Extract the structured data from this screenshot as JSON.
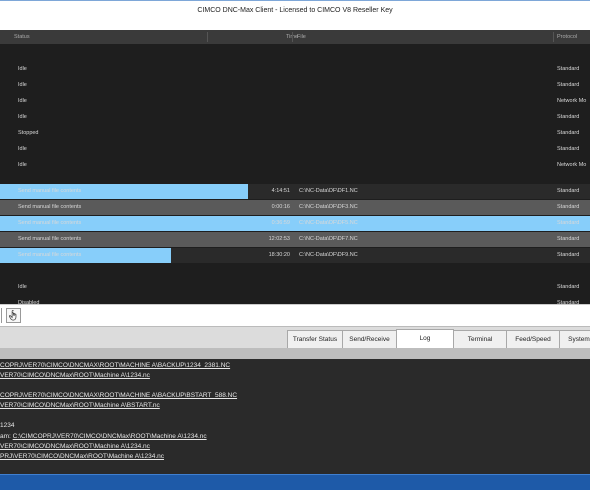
{
  "window": {
    "title": "CIMCO DNC-Max Client - Licensed to CIMCO V8 Reseller Key"
  },
  "grid": {
    "columns": {
      "status": "Status",
      "time": "Time",
      "file": "File",
      "protocol": "Protocol"
    },
    "rows": [
      {
        "status": "Idle",
        "time": "",
        "file": "",
        "protocol": "Standard"
      },
      {
        "status": "Idle",
        "time": "",
        "file": "",
        "protocol": "Standard"
      },
      {
        "status": "Idle",
        "time": "",
        "file": "",
        "protocol": "Network Mo"
      },
      {
        "status": "Idle",
        "time": "",
        "file": "",
        "protocol": "Standard"
      },
      {
        "status": "Stopped",
        "time": "",
        "file": "",
        "protocol": "Standard"
      },
      {
        "status": "Idle",
        "time": "",
        "file": "",
        "protocol": "Standard"
      },
      {
        "status": "Idle",
        "time": "",
        "file": "",
        "protocol": "Network Mo"
      },
      {
        "status": "Send manual file contents",
        "time": "4:14:51",
        "file": "C:\\NC-Data\\DF\\DF1.NC",
        "protocol": "Standard",
        "progress": 0.42
      },
      {
        "status": "Send manual file contents",
        "time": "0:00:16",
        "file": "C:\\NC-Data\\DF\\DF3.NC",
        "protocol": "Standard",
        "progress": 0
      },
      {
        "status": "Send manual file contents",
        "time": "0:36:59",
        "file": "C:\\NC-Data\\DF\\DF5.NC",
        "protocol": "Standard",
        "progress": 1
      },
      {
        "status": "Send manual file contents",
        "time": "12:02:53",
        "file": "C:\\NC-Data\\DF\\DF7.NC",
        "protocol": "Standard",
        "progress": 0
      },
      {
        "status": "Send manual file contents",
        "time": "18:30:20",
        "file": "C:\\NC-Data\\DF\\DF9.NC",
        "protocol": "Standard",
        "progress": 0.29
      },
      {
        "status": "Idle",
        "time": "",
        "file": "",
        "protocol": "Standard"
      },
      {
        "status": "Disabled",
        "time": "",
        "file": "",
        "protocol": "Standard"
      }
    ]
  },
  "tabs": [
    {
      "label": "Transfer Status"
    },
    {
      "label": "Send/Receive"
    },
    {
      "label": "Log",
      "active": true
    },
    {
      "label": "Terminal"
    },
    {
      "label": "Feed/Speed"
    },
    {
      "label": "System"
    }
  ],
  "log": [
    {
      "text": "COPRJ\\VER70\\CIMCO\\DNCMAX\\ROOT\\MACHINE A\\BACKUP\\1234_2381.NC",
      "link": true
    },
    {
      "text": "VER70\\CIMCO\\DNCMax\\ROOT\\Machine A\\1234.nc",
      "link": true
    },
    {
      "text": "",
      "link": false
    },
    {
      "text": "COPRJ\\VER70\\CIMCO\\DNCMAX\\ROOT\\MACHINE A\\BACKUP\\BSTART_588.NC",
      "link": true
    },
    {
      "text": "VER70\\CIMCO\\DNCMax\\ROOT\\Machine A\\BSTART.nc",
      "link": true
    },
    {
      "text": "",
      "link": false
    },
    {
      "text": "1234",
      "link": false
    },
    {
      "prefix": "am: ",
      "text": "C:\\CIMCOPRJ\\VER70\\CIMCO\\DNCMax\\ROOT\\Machine A\\1234.nc",
      "link": true
    },
    {
      "text": "VER70\\CIMCO\\DNCMax\\ROOT\\Machine A\\1234.nc",
      "link": true
    },
    {
      "text": "PRJ\\VER70\\CIMCO\\DNCMax\\ROOT\\Machine A\\1234.nc",
      "link": true
    }
  ],
  "colors": {
    "progress": "#87cefa",
    "grid_bg": "#1e1e1e",
    "statusbar": "#1e5aa8"
  },
  "icons": {
    "toolbar": "hand-pointer-icon"
  }
}
